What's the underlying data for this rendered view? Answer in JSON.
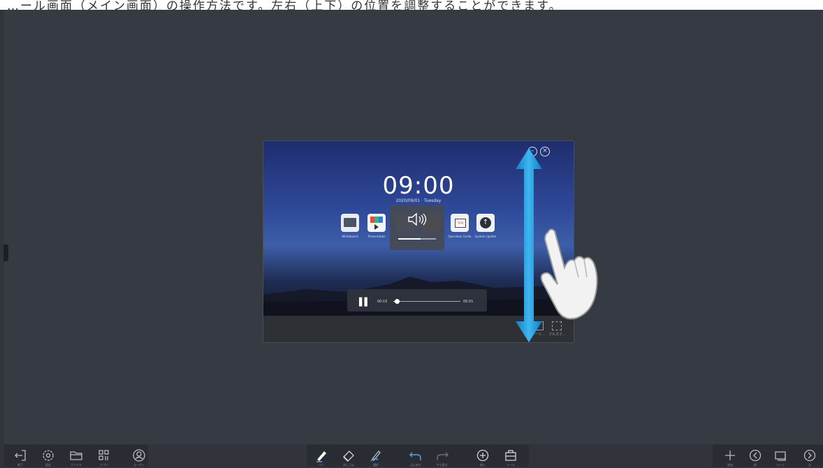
{
  "caption": "…ール画面（メイン画面）の操作方法です。左右（上下）の位置を調整することができます。",
  "player": {
    "clock": "09:00",
    "date": "2020/09/01 · Tuesday",
    "apps": [
      {
        "label": "Whiteboard",
        "icon": "whiteboard-icon"
      },
      {
        "label": "Presentation",
        "icon": "presentation-icon"
      },
      {
        "label": "",
        "icon": "app-icon"
      },
      {
        "label": "",
        "icon": "app-icon"
      },
      {
        "label": "Operation Guide",
        "icon": "guide-icon"
      },
      {
        "label": "System Update",
        "icon": "update-icon"
      }
    ],
    "volume_level": 0.6,
    "time_current": "00:15",
    "time_total": "05:01",
    "progress": 0.05,
    "footer": {
      "mirror_label": "ミラーリ…",
      "fullscreen_label": "フルスク…"
    }
  },
  "toolbar_left": [
    {
      "icon": "exit-icon",
      "label": "終了"
    },
    {
      "icon": "settings-icon",
      "label": "設定"
    },
    {
      "icon": "folder-icon",
      "label": "ファイル"
    },
    {
      "icon": "apps-icon",
      "label": "アプリ"
    },
    {
      "icon": "user-icon",
      "label": "ユーザー"
    }
  ],
  "toolbar_center": [
    {
      "icon": "pen-icon",
      "label": "ペン"
    },
    {
      "icon": "eraser-icon",
      "label": "消しゴム"
    },
    {
      "icon": "select-icon",
      "label": "選択"
    },
    {
      "icon": "undo-icon",
      "label": "元に戻す"
    },
    {
      "icon": "redo-icon",
      "label": "やり直す"
    },
    {
      "icon": "insert-icon",
      "label": "挿入"
    },
    {
      "icon": "tools-icon",
      "label": "ツール"
    }
  ],
  "toolbar_right": [
    {
      "icon": "add-page-icon",
      "label": "追加"
    },
    {
      "icon": "prev-page-icon",
      "label": "前"
    },
    {
      "icon": "pages-icon",
      "label": "ページ"
    },
    {
      "icon": "next-page-icon",
      "label": "次"
    }
  ],
  "colors": {
    "accent_arrow": "#1d9ce0",
    "background": "#363a42",
    "toolbar": "#292c32",
    "pen_accent": "#5aa0e8"
  }
}
